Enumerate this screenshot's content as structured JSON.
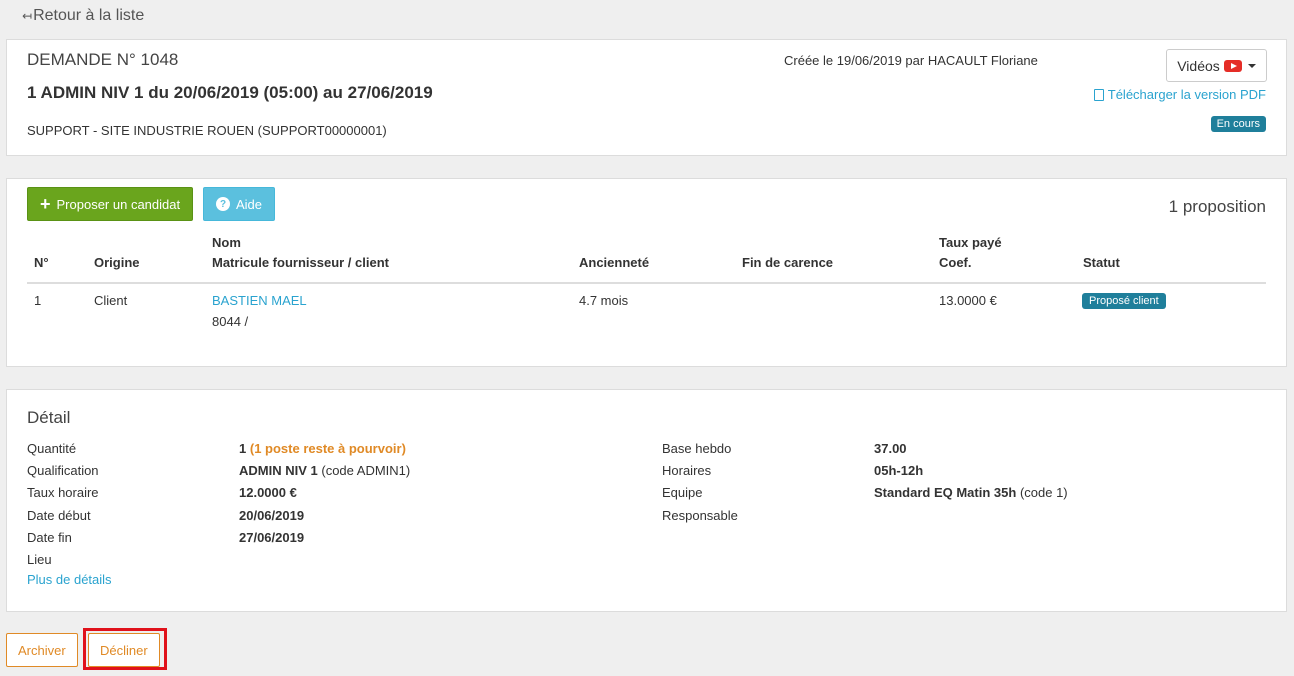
{
  "back": {
    "label": "Retour à la liste"
  },
  "header": {
    "title": "DEMANDE N° 1048",
    "subtitle": "1 ADMIN NIV 1 du 20/06/2019 (05:00) au 27/06/2019",
    "site": "SUPPORT - SITE INDUSTRIE ROUEN (SUPPORT00000001)",
    "created": "Créée le 19/06/2019 par HACAULT Floriane",
    "videos_label": "Vidéos",
    "pdf_label": "Télécharger la version PDF",
    "status": "En cours"
  },
  "candidates": {
    "propose_label": "Proposer un candidat",
    "help_label": "Aide",
    "count_label": "1 proposition",
    "columns": {
      "num": "N°",
      "origin": "Origine",
      "name_top": "Nom",
      "name_bottom": "Matricule fournisseur / client",
      "seniority": "Ancienneté",
      "end": "Fin de carence",
      "rate_top": "Taux payé",
      "rate_bottom": "Coef.",
      "status": "Statut"
    },
    "rows": [
      {
        "num": "1",
        "origin": "Client",
        "name": "BASTIEN MAEL",
        "matricule": "8044 /",
        "seniority": "4.7 mois",
        "end": "",
        "rate": "13.0000 €",
        "status": "Proposé client"
      }
    ]
  },
  "detail": {
    "title": "Détail",
    "left": [
      {
        "label": "Quantité",
        "value": "1",
        "extra": "(1 poste reste à pourvoir)"
      },
      {
        "label": "Qualification",
        "value": "ADMIN NIV 1",
        "extra": "(code ADMIN1)"
      },
      {
        "label": "Taux horaire",
        "value": "12.0000 €",
        "extra": ""
      },
      {
        "label": "Date début",
        "value": "20/06/2019",
        "extra": ""
      },
      {
        "label": "Date fin",
        "value": "27/06/2019",
        "extra": ""
      },
      {
        "label": "Lieu",
        "value": "",
        "extra": ""
      }
    ],
    "right": [
      {
        "label": "Base hebdo",
        "value": "37.00",
        "extra": ""
      },
      {
        "label": "Horaires",
        "value": "05h-12h",
        "extra": ""
      },
      {
        "label": "Equipe",
        "value": "Standard EQ Matin 35h",
        "extra": "(code 1)"
      },
      {
        "label": "Responsable",
        "value": "",
        "extra": ""
      }
    ],
    "more_label": "Plus de détails"
  },
  "actions": {
    "archive_label": "Archiver",
    "decline_label": "Décliner"
  },
  "colors": {
    "accent": "#2aa3cf",
    "success": "#6aa51d",
    "info": "#5bc0de",
    "warning": "#e08a26",
    "status": "#1f7f9b",
    "highlight": "#e0121b"
  }
}
